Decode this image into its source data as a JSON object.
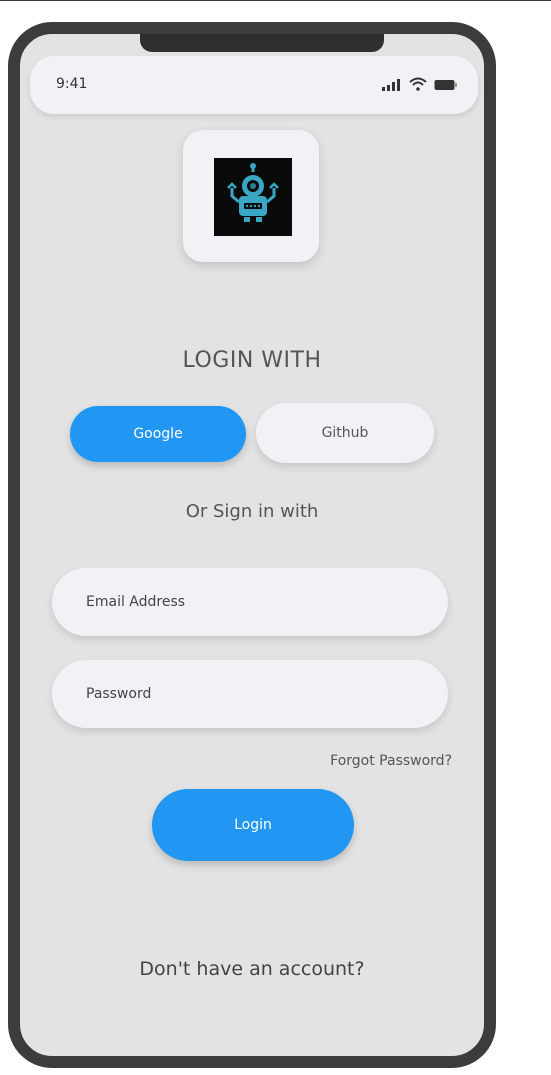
{
  "status_bar": {
    "time": "9:41",
    "icons": [
      "signal-icon",
      "wifi-icon",
      "battery-icon"
    ]
  },
  "logo": {
    "icon": "robot-icon"
  },
  "login": {
    "heading": "LOGIN WITH",
    "google_label": "Google",
    "github_label": "Github",
    "or_sign_in": "Or Sign in with",
    "email_placeholder": "Email Address",
    "password_placeholder": "Password",
    "forgot_password": "Forgot Password?",
    "login_button": "Login",
    "no_account": "Don't have an account?"
  },
  "colors": {
    "accent": "#2196f3",
    "screen_bg": "#e3e3e3",
    "card_bg": "#f1f2f6",
    "frame": "#3c3c3c"
  }
}
